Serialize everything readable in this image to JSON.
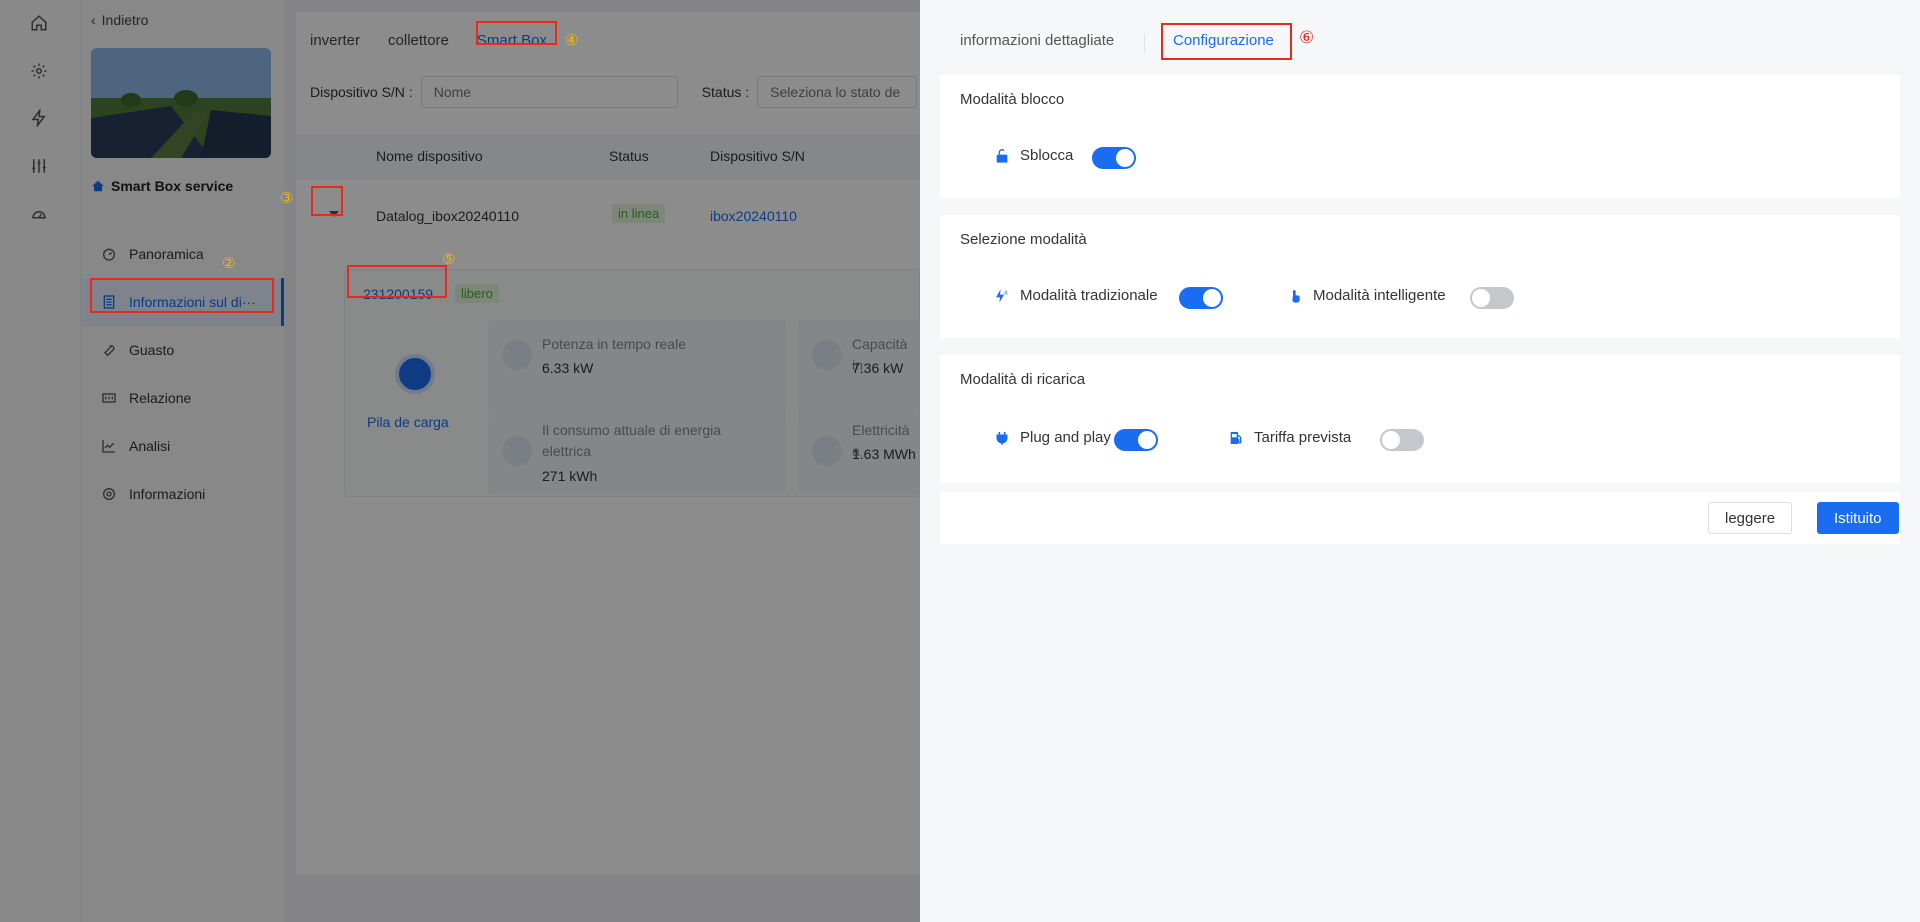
{
  "sidebar": {
    "back_label": "Indietro",
    "plant_name": "Smart Box service",
    "items": [
      {
        "label": "Panoramica",
        "icon": "dashboard-icon"
      },
      {
        "label": "Informazioni sul di···",
        "icon": "document-list-icon"
      },
      {
        "label": "Guasto",
        "icon": "wrench-icon"
      },
      {
        "label": "Relazione",
        "icon": "report-icon"
      },
      {
        "label": "Analisi",
        "icon": "line-chart-icon"
      },
      {
        "label": "Informazioni",
        "icon": "gear-icon"
      }
    ],
    "active_index": 1
  },
  "main": {
    "tabs": [
      "inverter",
      "collettore",
      "Smart Box"
    ],
    "active_tab": 2,
    "filters": {
      "sn_label": "Dispositivo S/N :",
      "sn_placeholder": "Nome",
      "status_label": "Status :",
      "status_placeholder": "Seleziona lo stato de"
    },
    "table": {
      "headers": [
        "Nome dispositivo",
        "Status",
        "Dispositivo S/N"
      ],
      "rows": [
        {
          "name": "Datalog_ibox20240110",
          "status": "in linea",
          "sn": "ibox20240110"
        }
      ]
    },
    "sub_panel": {
      "sn": "231200159",
      "state": "libero",
      "device_label": "Pila de carga",
      "stats": [
        {
          "label": "Potenza in tempo reale",
          "value": "6.33 kW"
        },
        {
          "label": "Capacità in",
          "value": "7.36 kW"
        },
        {
          "label": "Il consumo attuale di energia elettrica",
          "value": "271 kWh"
        },
        {
          "label": "Elettricità a",
          "value": "1.63 MWh"
        }
      ]
    }
  },
  "annotations": [
    "①",
    "②",
    "③",
    "④",
    "⑤",
    "⑥"
  ],
  "drawer": {
    "tabs": [
      "informazioni dettagliate",
      "Configurazione"
    ],
    "active_tab": 1,
    "sections": {
      "lock": {
        "title": "Modalità blocco",
        "options": [
          {
            "label": "Sblocca",
            "on": true,
            "icon": "lock-open-icon"
          }
        ]
      },
      "mode": {
        "title": "Selezione modalità",
        "options": [
          {
            "label": "Modalità tradizionale",
            "on": true,
            "icon": "flash-auto-icon"
          },
          {
            "label": "Modalità intelligente",
            "on": false,
            "icon": "touch-hand-icon"
          }
        ]
      },
      "charge": {
        "title": "Modalità di ricarica",
        "options": [
          {
            "label": "Plug and play",
            "on": true,
            "icon": "plug-icon"
          },
          {
            "label": "Tariffa prevista",
            "on": false,
            "icon": "fuel-pump-icon"
          }
        ]
      }
    },
    "buttons": {
      "read": "leggere",
      "set": "Istituito"
    }
  },
  "colors": {
    "accent": "#1a6cf0",
    "success_bg": "#e3f6dc",
    "success_text": "#4bab30",
    "annotation_red": "#e8291c",
    "annotation_orange": "#f5b80c"
  }
}
